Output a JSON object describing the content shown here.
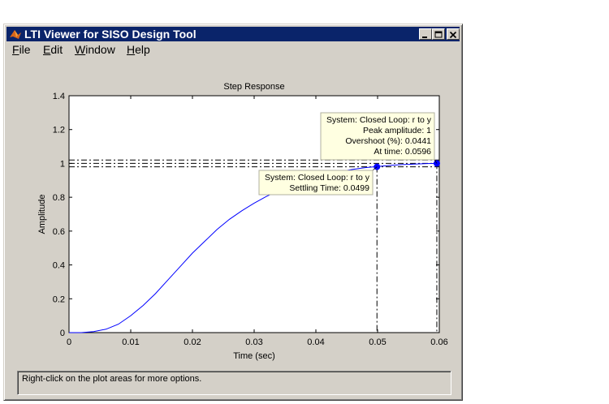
{
  "window": {
    "title": "LTI Viewer for SISO Design Tool"
  },
  "menu": {
    "file": {
      "mnemonic": "F",
      "rest": "ile"
    },
    "edit": {
      "mnemonic": "E",
      "rest": "dit"
    },
    "window": {
      "mnemonic": "W",
      "rest": "indow"
    },
    "help": {
      "mnemonic": "H",
      "rest": "elp"
    }
  },
  "status_text": "Right-click on the plot areas for more options.",
  "chart_data": {
    "type": "line",
    "title": "Step Response",
    "xlabel": "Time (sec)",
    "ylabel": "Amplitude",
    "xlim": [
      0,
      0.06
    ],
    "ylim": [
      0,
      1.4
    ],
    "xticks": [
      "0",
      "0.01",
      "0.02",
      "0.03",
      "0.04",
      "0.05",
      "0.06"
    ],
    "yticks": [
      "0",
      "0.2",
      "0.4",
      "0.6",
      "0.8",
      "1",
      "1.2",
      "1.4"
    ],
    "series": [
      {
        "color": "#0000ff",
        "x": [
          0,
          0.002,
          0.004,
          0.006,
          0.008,
          0.01,
          0.012,
          0.014,
          0.016,
          0.018,
          0.02,
          0.022,
          0.024,
          0.026,
          0.028,
          0.03,
          0.032,
          0.034,
          0.036,
          0.038,
          0.04,
          0.042,
          0.044,
          0.046,
          0.048,
          0.05,
          0.052,
          0.054,
          0.056,
          0.058,
          0.0596
        ],
        "y": [
          0,
          0.0,
          0.006,
          0.02,
          0.05,
          0.1,
          0.16,
          0.23,
          0.31,
          0.39,
          0.47,
          0.54,
          0.61,
          0.67,
          0.72,
          0.765,
          0.805,
          0.84,
          0.87,
          0.895,
          0.915,
          0.935,
          0.952,
          0.965,
          0.975,
          0.982,
          0.988,
          0.993,
          0.996,
          0.999,
          1.0
        ]
      }
    ],
    "reference_lines": {
      "dash_dot_y": [
        0.98,
        1.0,
        1.02
      ]
    },
    "markers": [
      {
        "name": "settling",
        "x": 0.0499,
        "y": 0.98,
        "label": [
          "System: Closed Loop: r to y",
          "Settling Time: 0.0499"
        ]
      },
      {
        "name": "peak",
        "x": 0.0596,
        "y": 1.0,
        "label": [
          "System: Closed Loop: r to y",
          "Peak amplitude: 1",
          "Overshoot (%): 0.0441",
          "At time: 0.0596"
        ]
      }
    ],
    "colors": {
      "line": "#0000ff",
      "marker": "#0000ff",
      "tooltip_bg": "#ffffe1"
    }
  }
}
